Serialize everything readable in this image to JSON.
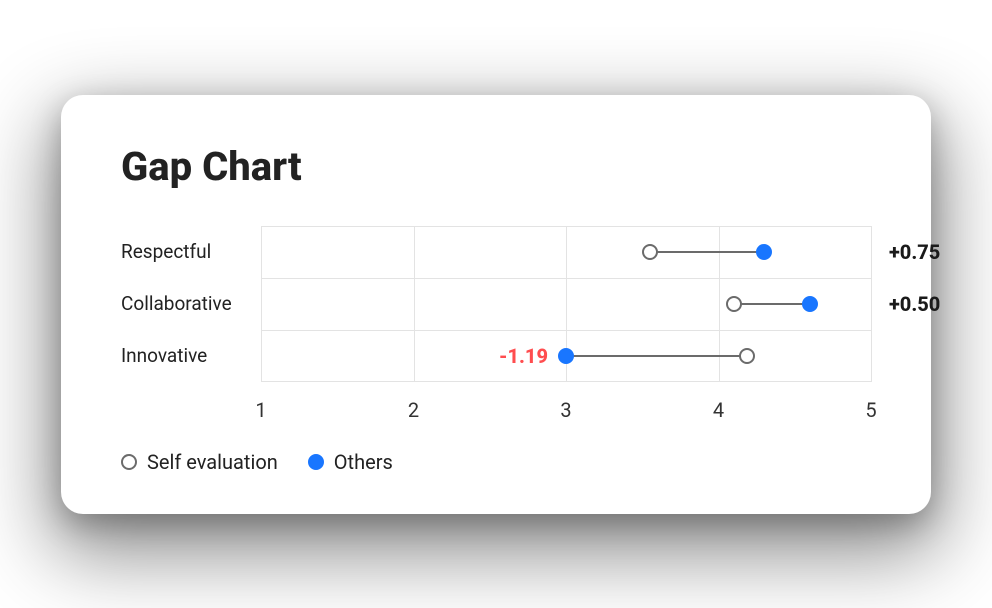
{
  "title": "Gap Chart",
  "legend": {
    "self": "Self evaluation",
    "others": "Others"
  },
  "axis": {
    "min": 1,
    "max": 5,
    "ticks": [
      1,
      2,
      3,
      4,
      5
    ]
  },
  "rows": [
    {
      "label": "Respectful",
      "self": 3.55,
      "others": 4.3,
      "gap": 0.75,
      "gap_text": "+0.75"
    },
    {
      "label": "Collaborative",
      "self": 4.1,
      "others": 4.6,
      "gap": 0.5,
      "gap_text": "+0.50"
    },
    {
      "label": "Innovative",
      "self": 4.19,
      "others": 3.0,
      "gap": -1.19,
      "gap_text": "-1.19"
    }
  ],
  "colors": {
    "others": "#1976ff",
    "self_border": "#6b6b6b",
    "grid": "#e3e3e3",
    "negative": "#ff4d4f"
  },
  "chart_data": {
    "type": "scatter",
    "title": "Gap Chart",
    "xlabel": "",
    "ylabel": "",
    "xlim": [
      1,
      5
    ],
    "categories": [
      "Respectful",
      "Collaborative",
      "Innovative"
    ],
    "series": [
      {
        "name": "Self evaluation",
        "values": [
          3.55,
          4.1,
          4.19
        ]
      },
      {
        "name": "Others",
        "values": [
          4.3,
          4.6,
          3.0
        ]
      }
    ],
    "gap": [
      0.75,
      0.5,
      -1.19
    ],
    "legend_position": "bottom-left",
    "grid": true
  }
}
